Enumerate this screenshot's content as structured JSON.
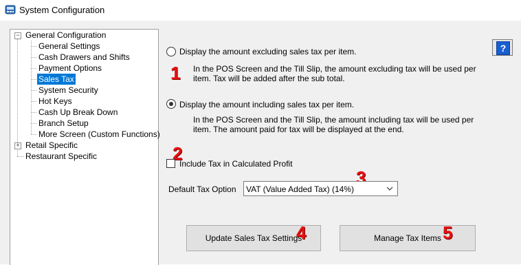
{
  "window": {
    "title": "System Configuration"
  },
  "tree": {
    "root": "General Configuration",
    "children": [
      "General Settings",
      "Cash Drawers and Shifts",
      "Payment Options",
      "Sales Tax",
      "System Security",
      "Hot Keys",
      "Cash Up Break Down",
      "Branch Setup",
      "More Screen (Custom Functions)"
    ],
    "selected": "Sales Tax",
    "retail": "Retail Specific",
    "restaurant": "Restaurant Specific"
  },
  "options": {
    "excluding": {
      "label": "Display the amount excluding sales tax per item.",
      "description": "In the POS Screen and the Till Slip, the amount excluding tax will be used per item. Tax will be added after the sub total.",
      "selected": false
    },
    "including": {
      "label": "Display the amount including sales tax per item.",
      "description": "In the POS Screen and the Till Slip, the amount including tax will be used per item. The amount paid for tax will be displayed at the end.",
      "selected": true
    },
    "include_tax_profit": {
      "label": "Include Tax in Calculated Profit",
      "checked": false
    }
  },
  "default_tax": {
    "label": "Default Tax Option",
    "value": "VAT (Value Added Tax) (14%)"
  },
  "buttons": {
    "update": "Update Sales Tax Settings",
    "manage": "Manage Tax Items",
    "help": "?"
  },
  "annotations": [
    "1",
    "2",
    "3",
    "4",
    "5"
  ],
  "colors": {
    "selection": "#0078d7",
    "annotation": "#e81010"
  }
}
